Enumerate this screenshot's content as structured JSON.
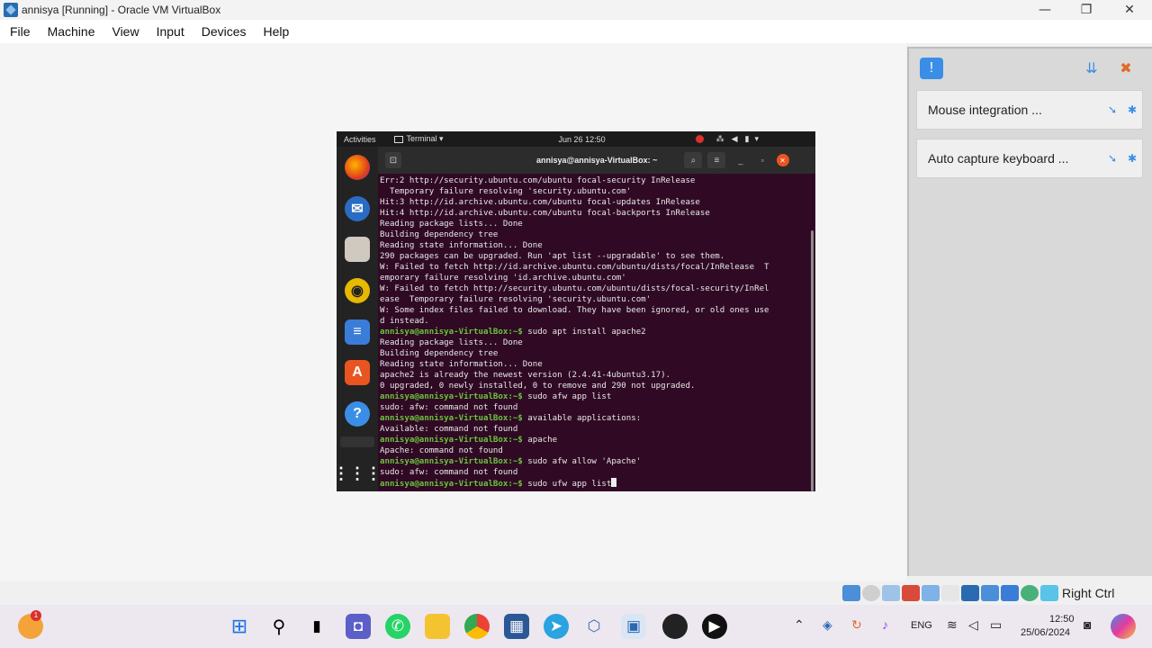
{
  "window": {
    "title": "annisya [Running] - Oracle VM VirtualBox",
    "minimize": "—",
    "restore": "❐",
    "close": "✕"
  },
  "menu": [
    "File",
    "Machine",
    "View",
    "Input",
    "Devices",
    "Help"
  ],
  "notifications": {
    "mouse_integration": "Mouse integration ...",
    "auto_capture": "Auto capture keyboard ..."
  },
  "vm": {
    "gnome": {
      "activities": "Activities",
      "app_menu": "Terminal ▾",
      "clock": "Jun 26  12:50"
    },
    "terminal": {
      "title": "annisya@annisya-VirtualBox: ~",
      "lines": [
        {
          "text": "Err:2 http://security.ubuntu.com/ubuntu focal-security InRelease",
          "kind": "normal"
        },
        {
          "text": "  Temporary failure resolving 'security.ubuntu.com'",
          "kind": "normal"
        },
        {
          "text": "Hit:3 http://id.archive.ubuntu.com/ubuntu focal-updates InRelease",
          "kind": "normal"
        },
        {
          "text": "Hit:4 http://id.archive.ubuntu.com/ubuntu focal-backports InRelease",
          "kind": "normal"
        },
        {
          "text": "Reading package lists... Done",
          "kind": "normal"
        },
        {
          "text": "Building dependency tree",
          "kind": "normal"
        },
        {
          "text": "Reading state information... Done",
          "kind": "normal"
        },
        {
          "text": "290 packages can be upgraded. Run 'apt list --upgradable' to see them.",
          "kind": "normal"
        },
        {
          "text": "W: Failed to fetch http://id.archive.ubuntu.com/ubuntu/dists/focal/InRelease  T",
          "kind": "warn"
        },
        {
          "text": "emporary failure resolving 'id.archive.ubuntu.com'",
          "kind": "normal"
        },
        {
          "text": "W: Failed to fetch http://security.ubuntu.com/ubuntu/dists/focal-security/InRel",
          "kind": "warn"
        },
        {
          "text": "ease  Temporary failure resolving 'security.ubuntu.com'",
          "kind": "normal"
        },
        {
          "text": "W: Some index files failed to download. They have been ignored, or old ones use",
          "kind": "warn"
        },
        {
          "text": "d instead.",
          "kind": "normal"
        },
        {
          "prompt": "annisya@annisya-VirtualBox:~$",
          "text": " sudo apt install apache2",
          "kind": "prompt"
        },
        {
          "text": "Reading package lists... Done",
          "kind": "normal"
        },
        {
          "text": "Building dependency tree",
          "kind": "normal"
        },
        {
          "text": "Reading state information... Done",
          "kind": "normal"
        },
        {
          "text": "apache2 is already the newest version (2.4.41-4ubuntu3.17).",
          "kind": "normal"
        },
        {
          "text": "0 upgraded, 0 newly installed, 0 to remove and 290 not upgraded.",
          "kind": "normal"
        },
        {
          "prompt": "annisya@annisya-VirtualBox:~$",
          "text": " sudo afw app list",
          "kind": "prompt"
        },
        {
          "text": "sudo: afw: command not found",
          "kind": "normal"
        },
        {
          "prompt": "annisya@annisya-VirtualBox:~$",
          "text": " available applications:",
          "kind": "prompt"
        },
        {
          "text": "Available: command not found",
          "kind": "normal"
        },
        {
          "prompt": "annisya@annisya-VirtualBox:~$",
          "text": " apache",
          "kind": "prompt"
        },
        {
          "text": "Apache: command not found",
          "kind": "normal"
        },
        {
          "prompt": "annisya@annisya-VirtualBox:~$",
          "text": " sudo afw allow 'Apache'",
          "kind": "prompt"
        },
        {
          "text": "sudo: afw: command not found",
          "kind": "normal"
        },
        {
          "prompt": "annisya@annisya-VirtualBox:~$",
          "text": " sudo ufw app list",
          "kind": "prompt",
          "cursor": true
        }
      ]
    }
  },
  "statusbar": {
    "host_key": "Right Ctrl"
  },
  "taskbar": {
    "language": "ENG",
    "time": "12:50",
    "date": "25/06/2024",
    "badge": "1"
  },
  "colors": {
    "terminal_bg": "#300a24",
    "prompt": "#6ac43d",
    "dock_bg": "#232323"
  }
}
